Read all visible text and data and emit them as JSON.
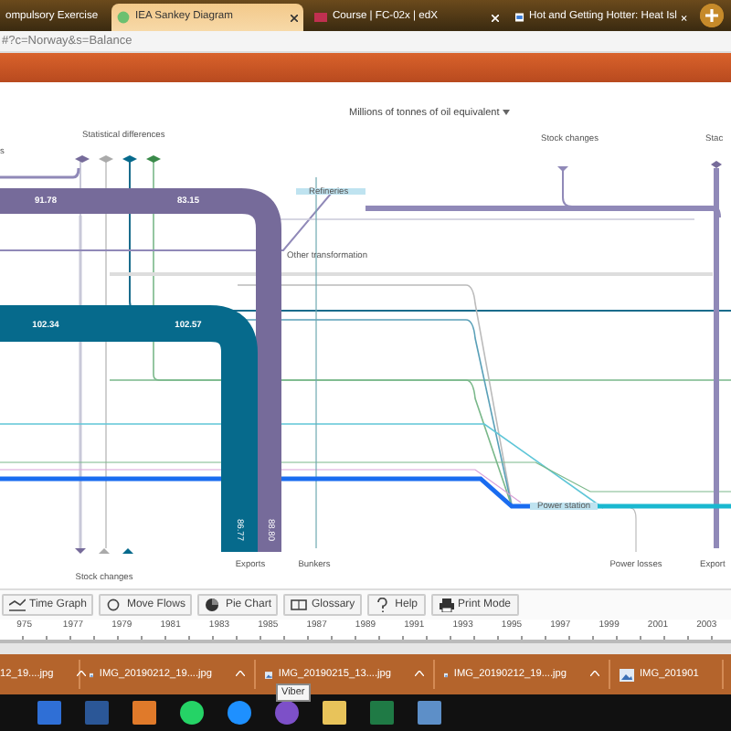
{
  "browser_tabs": [
    {
      "title": "ompulsory Exercise",
      "selected": false
    },
    {
      "title": "IEA Sankey Diagram",
      "selected": true
    },
    {
      "title": "Course | FC-02x | edX",
      "selected": false
    },
    {
      "title": "Hot and Getting Hotter: Heat Isl",
      "selected": false
    }
  ],
  "address_bar": {
    "url": "#?c=Norway&s=Balance"
  },
  "unit_selector": {
    "label": "Millions of tonnes of oil equivalent"
  },
  "sankey": {
    "labels": [
      {
        "text": "s",
        "kind": "node"
      },
      {
        "text": "Statistical differences",
        "kind": "node"
      },
      {
        "text": "91.78",
        "kind": "value"
      },
      {
        "text": "83.15",
        "kind": "value"
      },
      {
        "text": "Refineries",
        "kind": "node"
      },
      {
        "text": "Other transformation",
        "kind": "node"
      },
      {
        "text": "102.34",
        "kind": "value"
      },
      {
        "text": "102.57",
        "kind": "value"
      },
      {
        "text": "Stock changes",
        "kind": "node"
      },
      {
        "text": "Stac",
        "kind": "node"
      },
      {
        "text": "86.77",
        "kind": "vertical_value"
      },
      {
        "text": "88.80",
        "kind": "vertical_value"
      },
      {
        "text": "Power station",
        "kind": "node"
      },
      {
        "text": "Exports",
        "kind": "node"
      },
      {
        "text": "Bunkers",
        "kind": "node"
      },
      {
        "text": "Stock changes",
        "kind": "node"
      },
      {
        "text": "Power losses",
        "kind": "node"
      },
      {
        "text": "Export",
        "kind": "node"
      }
    ]
  },
  "toolbar": [
    {
      "label": "Time Graph",
      "kind": "timegraph"
    },
    {
      "label": "Move Flows",
      "kind": "move"
    },
    {
      "label": "Pie Chart",
      "kind": "pie"
    },
    {
      "label": "Glossary",
      "kind": "glossary"
    },
    {
      "label": "Help",
      "kind": "help"
    },
    {
      "label": "Print Mode",
      "kind": "print"
    }
  ],
  "timeline": {
    "years": [
      "975",
      "1977",
      "1979",
      "1981",
      "1983",
      "1985",
      "1987",
      "1989",
      "1991",
      "1993",
      "1995",
      "1997",
      "1999",
      "2001",
      "2003"
    ]
  },
  "downloads": [
    {
      "name": "12_19....jpg"
    },
    {
      "name": "IMG_20190212_19....jpg"
    },
    {
      "name": "IMG_20190215_13....jpg"
    },
    {
      "name": "IMG_20190212_19....jpg"
    },
    {
      "name": "IMG_201901"
    }
  ],
  "tooltip": {
    "text": "Viber"
  }
}
